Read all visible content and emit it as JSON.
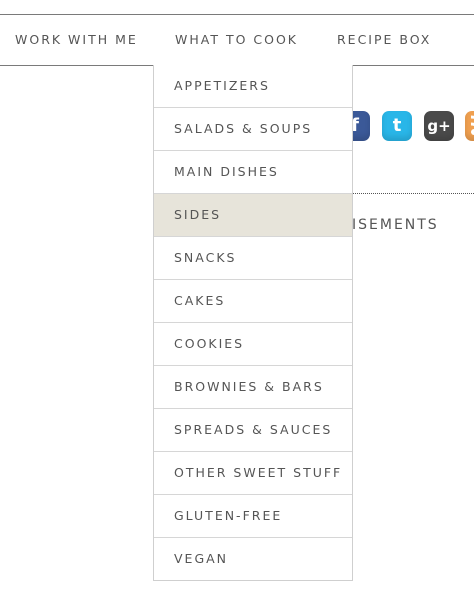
{
  "nav": {
    "items": [
      {
        "label": "WORK WITH ME"
      },
      {
        "label": "WHAT TO COOK"
      },
      {
        "label": "RECIPE BOX"
      }
    ]
  },
  "social": {
    "icons": [
      {
        "name": "facebook-icon",
        "glyph": "f",
        "color": "#3b5998"
      },
      {
        "name": "twitter-icon",
        "glyph": "t",
        "color": "#29b6e8"
      },
      {
        "name": "google-plus-icon",
        "glyph": "g+",
        "color": "#4a4a4a"
      },
      {
        "name": "rss-icon",
        "glyph": "",
        "color": "#f0a050"
      }
    ]
  },
  "sidebar": {
    "ad_heading": "ISEMENTS"
  },
  "dropdown": {
    "active_index": 3,
    "active_color": "#e7e4da",
    "items": [
      {
        "label": "APPETIZERS"
      },
      {
        "label": "SALADS & SOUPS"
      },
      {
        "label": "MAIN DISHES"
      },
      {
        "label": "SIDES"
      },
      {
        "label": "SNACKS"
      },
      {
        "label": "CAKES"
      },
      {
        "label": "COOKIES"
      },
      {
        "label": "BROWNIES & BARS"
      },
      {
        "label": "SPREADS & SAUCES"
      },
      {
        "label": "OTHER SWEET STUFF"
      },
      {
        "label": "GLUTEN-FREE"
      },
      {
        "label": "VEGAN"
      }
    ]
  }
}
